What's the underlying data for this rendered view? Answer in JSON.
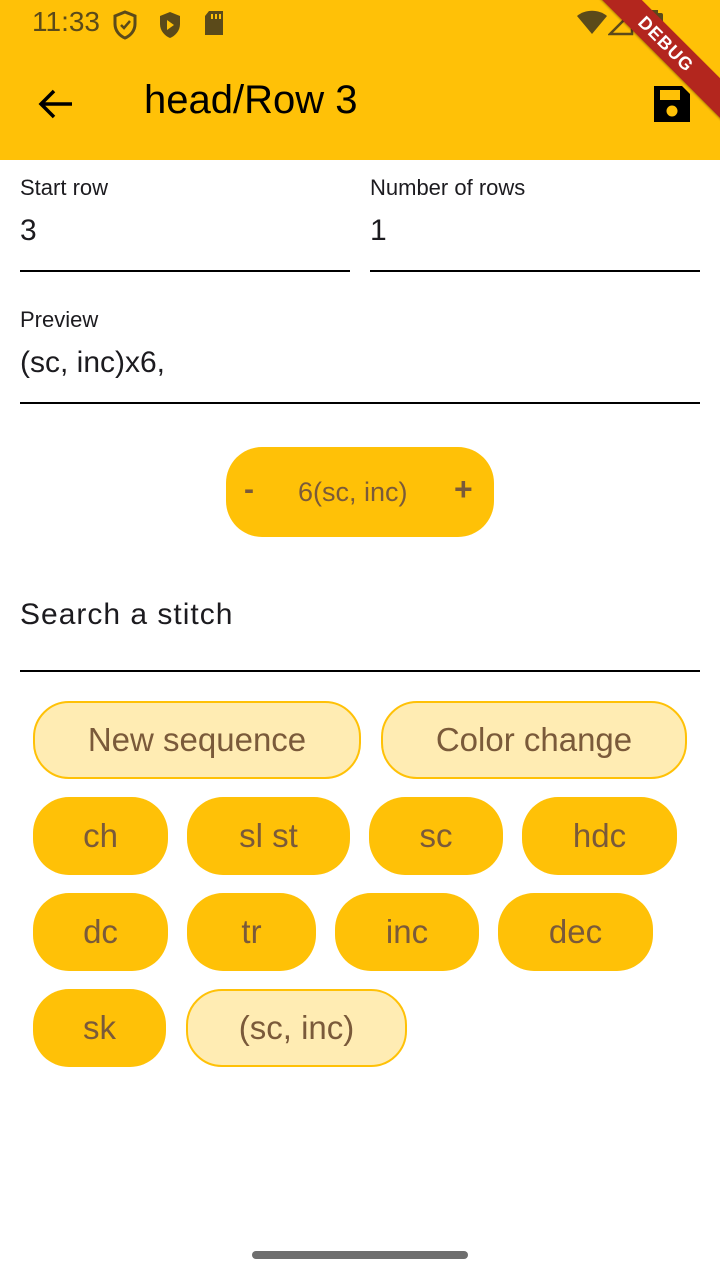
{
  "status_bar": {
    "time": "11:33",
    "debug_label": "DEBUG"
  },
  "header": {
    "title": "head/Row 3",
    "back_icon": "arrow-back-icon",
    "save_icon": "save-icon"
  },
  "form": {
    "start_row_label": "Start row",
    "start_row_value": "3",
    "rows_label": "Number of rows",
    "rows_value": "1",
    "preview_label": "Preview",
    "preview_value": "(sc, inc)x6,"
  },
  "counter": {
    "minus": "-",
    "text": "6(sc, inc)",
    "plus": "+"
  },
  "search": {
    "placeholder": "Search a stitch"
  },
  "chips": [
    {
      "label": "New sequence",
      "style": "outline"
    },
    {
      "label": "Color change",
      "style": "outline"
    },
    {
      "label": "ch",
      "style": "fill"
    },
    {
      "label": "sl st",
      "style": "fill"
    },
    {
      "label": "sc",
      "style": "fill"
    },
    {
      "label": "hdc",
      "style": "fill"
    },
    {
      "label": "dc",
      "style": "fill"
    },
    {
      "label": "tr",
      "style": "fill"
    },
    {
      "label": "inc",
      "style": "fill"
    },
    {
      "label": "dec",
      "style": "fill"
    },
    {
      "label": "sk",
      "style": "fill"
    },
    {
      "label": "(sc, inc)",
      "style": "outline"
    }
  ],
  "colors": {
    "primary": "#FFC107",
    "chip_outline_bg": "#FFECB3",
    "chip_text": "#7a5a3a"
  }
}
